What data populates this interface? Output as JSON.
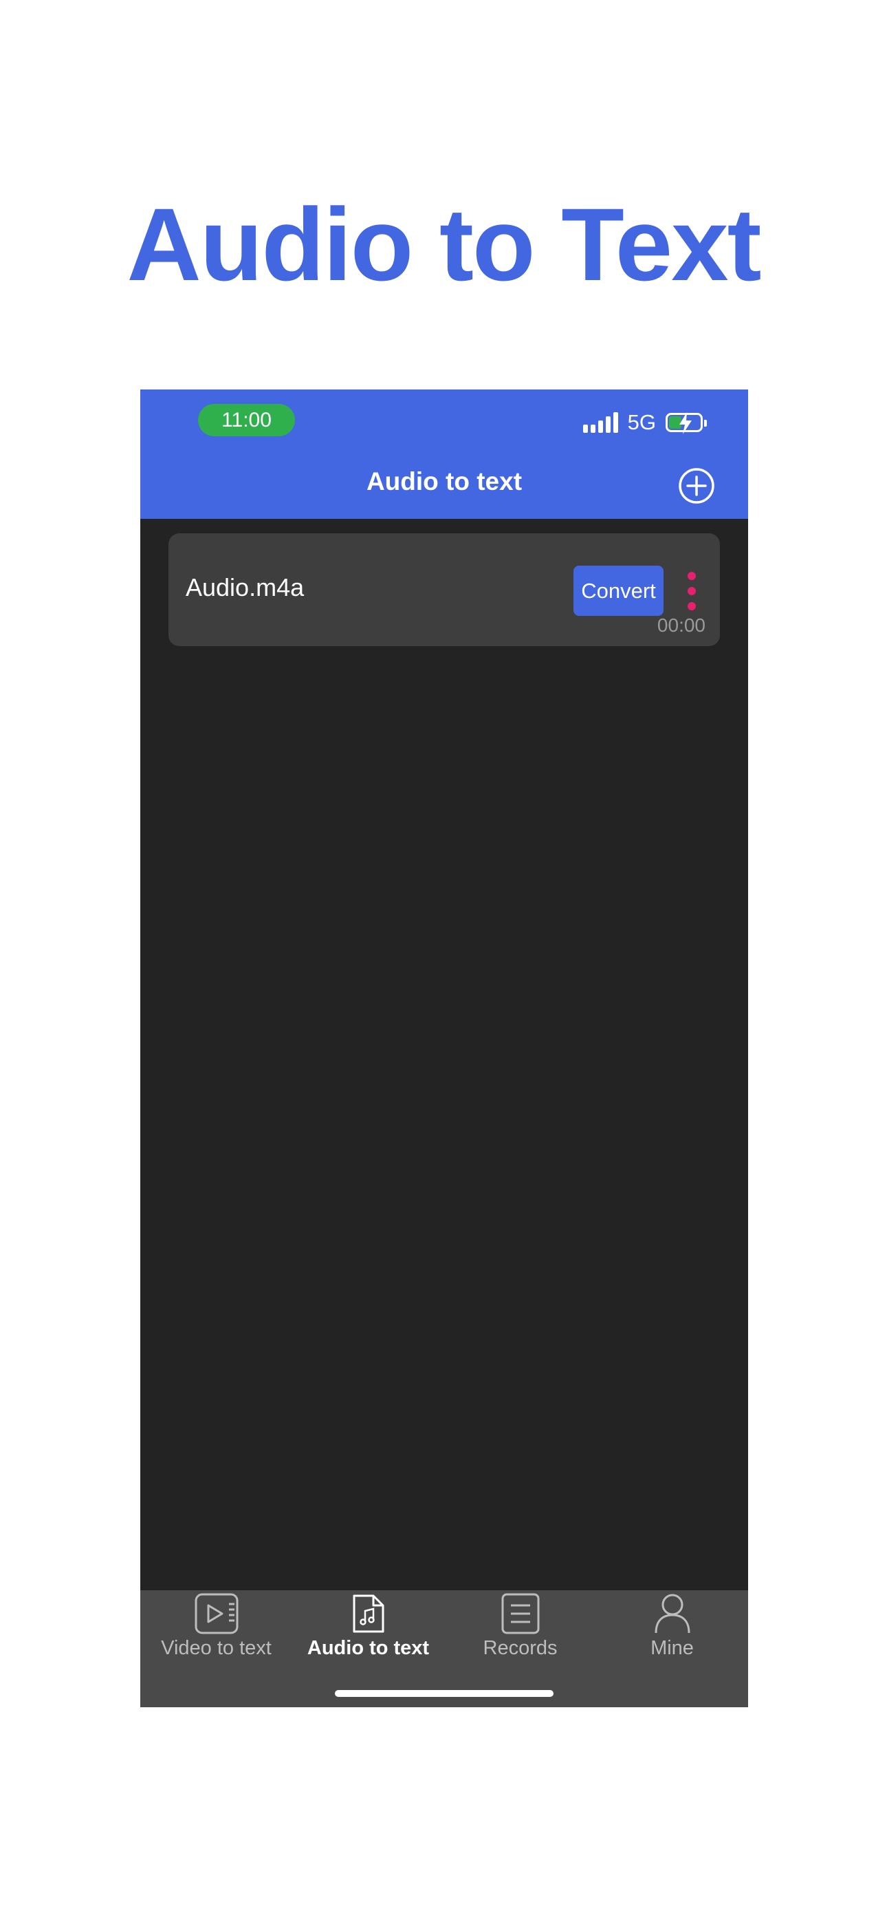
{
  "hero": {
    "title": "Audio to Text"
  },
  "status_bar": {
    "time": "11:00",
    "network": "5G"
  },
  "header": {
    "title": "Audio to text",
    "add_icon": "plus-circle-icon"
  },
  "file_item": {
    "name": "Audio.m4a",
    "convert_label": "Convert",
    "duration": "00:00",
    "more_icon": "more-vertical-icon"
  },
  "tabs": [
    {
      "label": "Video to text",
      "icon": "video-file-icon",
      "active": false
    },
    {
      "label": "Audio to text",
      "icon": "audio-file-icon",
      "active": true
    },
    {
      "label": "Records",
      "icon": "records-list-icon",
      "active": false
    },
    {
      "label": "Mine",
      "icon": "user-icon",
      "active": false
    }
  ],
  "colors": {
    "brand": "#4267e1",
    "time_pill": "#2fb04d",
    "more_dots": "#e8206f",
    "content_bg": "#232323",
    "card_bg": "#3e3e3e",
    "tabbar_bg": "#4a4a4a"
  }
}
